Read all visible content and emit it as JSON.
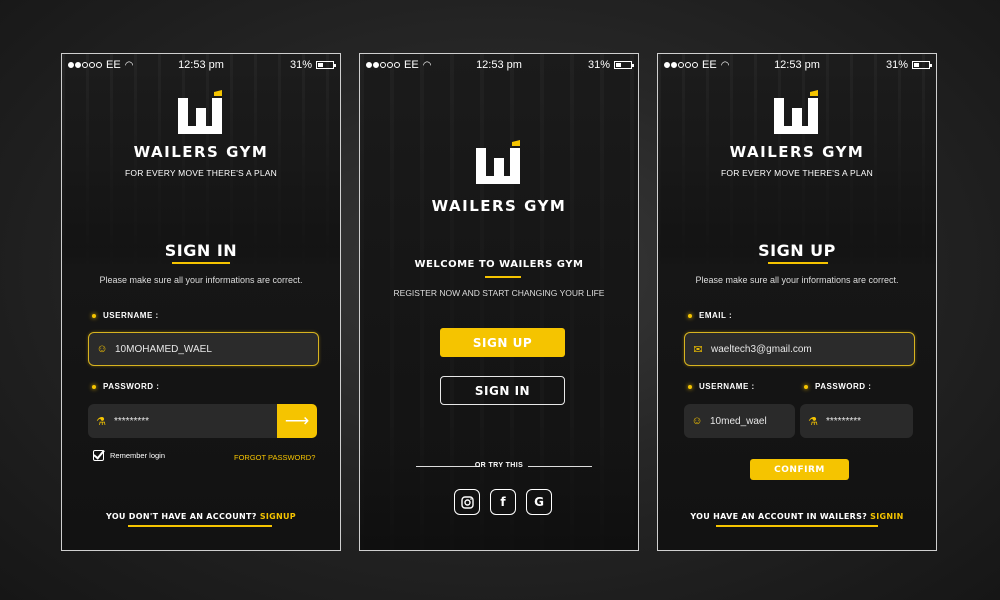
{
  "status": {
    "carrier": "EE",
    "time": "12:53 pm",
    "battery": "31%"
  },
  "brand": {
    "name": "WAILERS GYM",
    "tagline": "FOR EVERY MOVE THERE'S A PLAN",
    "accent": "#f5c400"
  },
  "signin": {
    "title": "SIGN IN",
    "note": "Please make sure all your informations are correct.",
    "username_label": "USERNAME :",
    "username_value": "10MOHAMED_WAEL",
    "password_label": "PASSWORD :",
    "password_value": "*********",
    "remember": "Remember login",
    "forgot": "FORGOT PASSWORD?",
    "bottom_text": "YOU DON'T HAVE AN ACCOUNT?",
    "bottom_link": "SIGNUP"
  },
  "welcome": {
    "title": "WELCOME TO WAILERS GYM",
    "subtitle": "REGISTER NOW AND START CHANGING YOUR LIFE",
    "signup_button": "SIGN UP",
    "signin_button": "SIGN IN",
    "or_text": "OR TRY THIS",
    "social": [
      "instagram-icon",
      "facebook-icon",
      "google-icon"
    ]
  },
  "signup": {
    "title": "SIGN UP",
    "note": "Please make sure  all your informations are correct.",
    "email_label": "EMAIL :",
    "email_value": "waeltech3@gmail.com",
    "username_label": "USERNAME :",
    "username_value": "10med_wael",
    "password_label": "PASSWORD :",
    "password_value": "*********",
    "confirm_button": "CONFIRM",
    "bottom_text": "YOU HAVE AN ACCOUNT IN WAILERS?",
    "bottom_link": "SIGNIN"
  }
}
